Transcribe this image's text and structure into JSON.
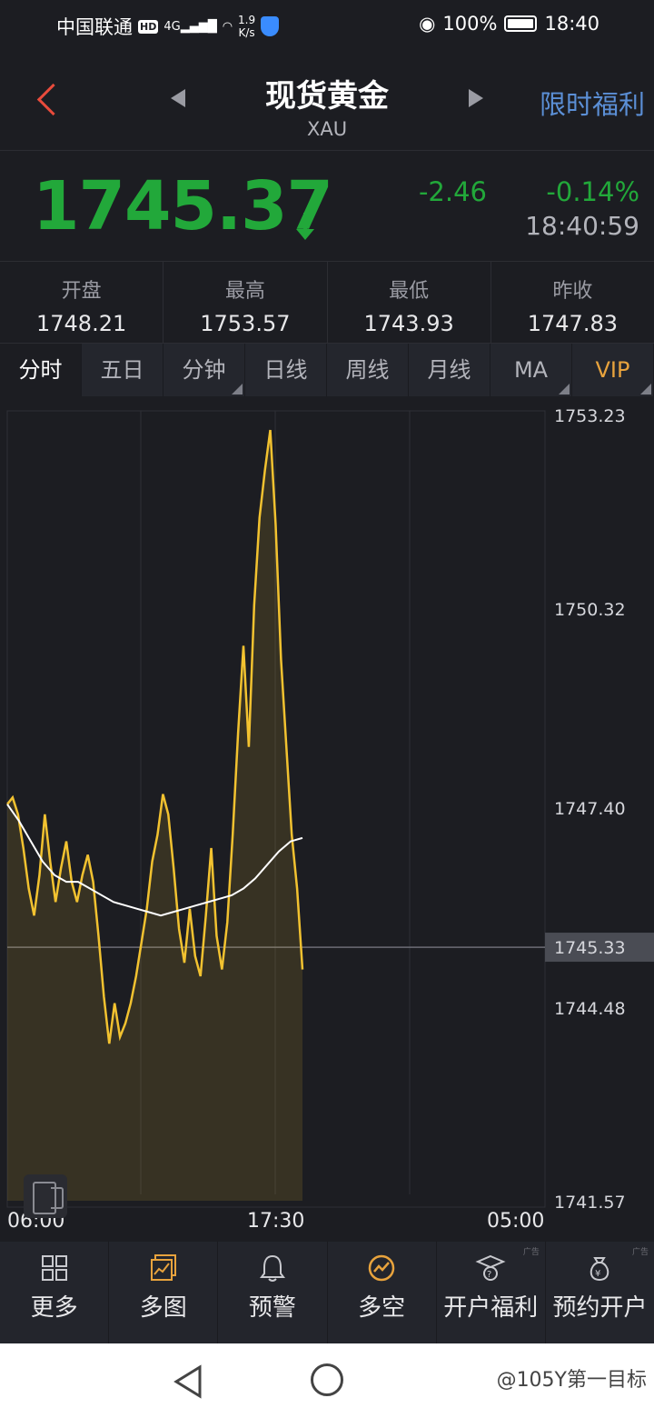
{
  "status": {
    "carrier": "中国联通",
    "hd": "HD",
    "signal": "4G",
    "speed": "1.9\nK/s",
    "battery": "100%",
    "time": "18:40"
  },
  "header": {
    "title": "现货黄金",
    "subtitle": "XAU",
    "promo": "限时福利"
  },
  "quote": {
    "price": "1745.37",
    "change": "-2.46",
    "change_pct": "-0.14%",
    "time": "18:40:59",
    "color": "#22a83a"
  },
  "stats": [
    {
      "label": "开盘",
      "value": "1748.21"
    },
    {
      "label": "最高",
      "value": "1753.57"
    },
    {
      "label": "最低",
      "value": "1743.93"
    },
    {
      "label": "昨收",
      "value": "1747.83"
    }
  ],
  "tabs": [
    "分时",
    "五日",
    "分钟",
    "日线",
    "周线",
    "月线",
    "MA",
    "VIP"
  ],
  "chart": {
    "y_ticks": [
      "1753.23",
      "1750.32",
      "1747.40",
      "1744.48",
      "1741.57"
    ],
    "x_ticks": [
      "06:00",
      "17:30",
      "05:00"
    ],
    "current_label": "1745.33",
    "line_color": "#f2c230",
    "avg_color": "#ffffff"
  },
  "chart_data": {
    "type": "line",
    "y_range": [
      1741.57,
      1753.23
    ],
    "current": 1745.33,
    "series": [
      {
        "values": [
          1747.45,
          1747.55,
          1747.3,
          1746.8,
          1746.2,
          1745.8,
          1746.4,
          1747.3,
          1746.6,
          1746.0,
          1746.5,
          1746.9,
          1746.3,
          1746.0,
          1746.4,
          1746.7,
          1746.3,
          1745.5,
          1744.6,
          1743.9,
          1744.5,
          1744.0,
          1744.2,
          1744.5,
          1744.9,
          1745.4,
          1745.9,
          1746.6,
          1747.0,
          1747.6,
          1747.3,
          1746.5,
          1745.6,
          1745.1,
          1745.9,
          1745.2,
          1744.9,
          1745.8,
          1746.8,
          1745.5,
          1745.0,
          1745.7,
          1747.0,
          1748.5,
          1749.8,
          1748.3,
          1750.4,
          1751.7,
          1752.4,
          1753.0,
          1751.6,
          1749.6,
          1748.3,
          1747.0,
          1746.2,
          1745.0
        ],
        "color": "#f2c230"
      },
      {
        "values": [
          1747.45,
          1747.2,
          1746.9,
          1746.6,
          1746.4,
          1746.3,
          1746.3,
          1746.2,
          1746.1,
          1746.0,
          1745.95,
          1745.9,
          1745.85,
          1745.8,
          1745.85,
          1745.9,
          1745.95,
          1746.0,
          1746.05,
          1746.1,
          1746.2,
          1746.35,
          1746.55,
          1746.75,
          1746.9,
          1746.95
        ],
        "color": "#ffffff"
      }
    ]
  },
  "toolbar": [
    {
      "label": "更多",
      "ad": ""
    },
    {
      "label": "多图",
      "ad": ""
    },
    {
      "label": "预警",
      "ad": ""
    },
    {
      "label": "多空",
      "ad": ""
    },
    {
      "label": "开户福利",
      "ad": "广告"
    },
    {
      "label": "预约开户",
      "ad": "广告"
    }
  ],
  "watermark": "@105Y第一目标"
}
